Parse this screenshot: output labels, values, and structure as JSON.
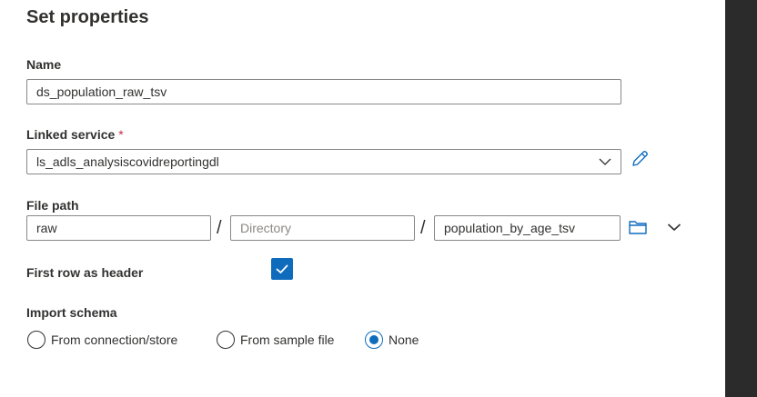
{
  "panel": {
    "title": "Set properties"
  },
  "name_field": {
    "label": "Name",
    "value": "ds_population_raw_tsv"
  },
  "linked_service": {
    "label": "Linked service",
    "required_mark": "*",
    "value": "ls_adls_analysiscovidreportingdl",
    "edit_icon": "pencil-icon",
    "dropdown_icon": "chevron-down-icon"
  },
  "file_path": {
    "label": "File path",
    "container": "raw",
    "separator": "/",
    "directory_placeholder": "Directory",
    "file": "population_by_age_tsv",
    "browse_icon": "folder-icon",
    "more_icon": "chevron-down-icon"
  },
  "first_row_header": {
    "label": "First row as header",
    "checked": true
  },
  "import_schema": {
    "label": "Import schema",
    "options": [
      {
        "label": "From connection/store",
        "selected": false
      },
      {
        "label": "From sample file",
        "selected": false
      },
      {
        "label": "None",
        "selected": true
      }
    ]
  },
  "colors": {
    "accent": "#0f6cbd",
    "required": "#c4314b",
    "scrollbar": "#2b2b2b"
  }
}
